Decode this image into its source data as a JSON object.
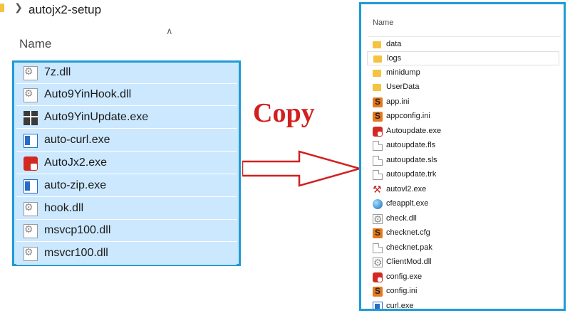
{
  "left": {
    "breadcrumb": "autojx2-setup",
    "name_header": "Name",
    "files": [
      {
        "name": "7z.dll",
        "icon": "dll-file-icon"
      },
      {
        "name": "Auto9YinHook.dll",
        "icon": "dll-file-icon"
      },
      {
        "name": "Auto9YinUpdate.exe",
        "icon": "gift-exe-icon"
      },
      {
        "name": "auto-curl.exe",
        "icon": "window-exe-icon"
      },
      {
        "name": "AutoJx2.exe",
        "icon": "autojx2-app-icon"
      },
      {
        "name": "auto-zip.exe",
        "icon": "window-exe-icon"
      },
      {
        "name": "hook.dll",
        "icon": "dll-file-icon"
      },
      {
        "name": "msvcp100.dll",
        "icon": "dll-file-icon"
      },
      {
        "name": "msvcr100.dll",
        "icon": "dll-file-icon"
      }
    ]
  },
  "middle": {
    "copy_label": "Copy",
    "accent_color": "#d2201f"
  },
  "right": {
    "name_header": "Name",
    "files": [
      {
        "name": "data",
        "icon": "folder-icon"
      },
      {
        "name": "logs",
        "icon": "folder-icon"
      },
      {
        "name": "minidump",
        "icon": "folder-icon"
      },
      {
        "name": "UserData",
        "icon": "folder-icon"
      },
      {
        "name": "app.ini",
        "icon": "ini-file-icon"
      },
      {
        "name": "appconfig.ini",
        "icon": "ini-file-icon"
      },
      {
        "name": "Autoupdate.exe",
        "icon": "autoupdate-app-icon"
      },
      {
        "name": "autoupdate.fls",
        "icon": "blank-file-icon"
      },
      {
        "name": "autoupdate.sls",
        "icon": "blank-file-icon"
      },
      {
        "name": "autoupdate.trk",
        "icon": "blank-file-icon"
      },
      {
        "name": "autovl2.exe",
        "icon": "tool-exe-icon"
      },
      {
        "name": "cfeapplt.exe",
        "icon": "globe-exe-icon"
      },
      {
        "name": "check.dll",
        "icon": "dll-file-icon"
      },
      {
        "name": "checknet.cfg",
        "icon": "ini-file-icon"
      },
      {
        "name": "checknet.pak",
        "icon": "blank-file-icon"
      },
      {
        "name": "ClientMod.dll",
        "icon": "dll-file-icon"
      },
      {
        "name": "config.exe",
        "icon": "autoupdate-app-icon"
      },
      {
        "name": "config.ini",
        "icon": "ini-file-icon"
      },
      {
        "name": "curl.exe",
        "icon": "window-exe-icon"
      }
    ]
  },
  "colors": {
    "selection_border": "#1f9bd6",
    "selection_fill": "#cce8ff"
  }
}
